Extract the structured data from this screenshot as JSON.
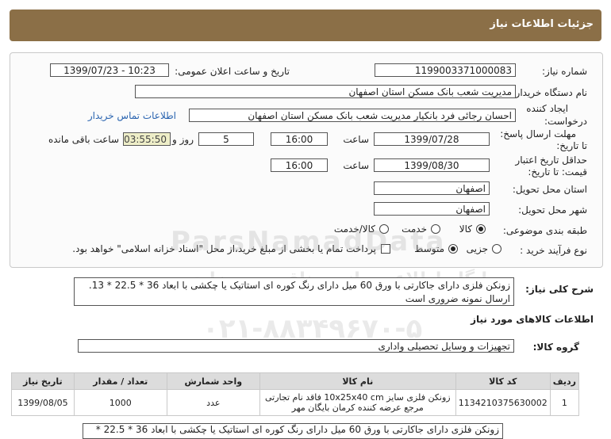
{
  "header": {
    "title": "جزئیات اطلاعات نیاز"
  },
  "fields": {
    "need_number_label": "شماره نیاز:",
    "need_number": "1199003371000083",
    "announce_label": "تاریخ و ساعت اعلان عمومی:",
    "announce_value": "1399/07/23 - 10:23",
    "buyer_label": "نام دستگاه خریدار:",
    "buyer_value": "مدیریت شعب بانک مسکن استان اصفهان",
    "creator_label_1": "ایجاد کننده",
    "creator_label_2": "درخواست:",
    "creator_value": "احسان  رجائی فرد  بانکیار  مدیریت شعب بانک مسکن استان اصفهان",
    "contact_link": "اطلاعات تماس خریدار",
    "deadline_label_1": "مهلت ارسال پاسخ:",
    "deadline_label_2": "تا تاریخ:",
    "deadline_date": "1399/07/28",
    "time_label": "ساعت",
    "deadline_time": "16:00",
    "days_value": "5",
    "days_label": "روز و",
    "remaining_time": "03:55:50",
    "remaining_label": "ساعت باقی مانده",
    "validity_label_1": "حداقل تاریخ اعتبار",
    "validity_label_2": "قیمت: تا تاریخ:",
    "validity_date": "1399/08/30",
    "validity_time_label": "ساعت",
    "validity_time": "16:00",
    "province_label": "استان محل تحویل:",
    "province_value": "اصفهان",
    "city_label": "شهر محل تحویل:",
    "city_value": "اصفهان",
    "category_label": "طبقه بندی موضوعی:",
    "category_options": [
      "کالا",
      "خدمت",
      "کالا/خدمت"
    ],
    "purchase_label": "نوع فرآیند خرید :",
    "purchase_options": [
      "جزیی",
      "متوسط"
    ],
    "payment_note": "پرداخت تمام یا بخشی از مبلغ خرید،از محل \"اسناد خزانه اسلامی\" خواهد بود."
  },
  "summary": {
    "label": "شرح کلی نیاز:",
    "text": "زونکن فلزی دارای جاکارتی با ورق 60 میل دارای رنگ کوره ای استاتیک یا چکشی با ابعاد 36 * 22.5 * 13. ارسال نمونه ضروری است"
  },
  "goods": {
    "section_title": "اطلاعات کالاهای مورد نیاز",
    "group_label": "گروه کالا:",
    "group_value": "تجهیزات و وسایل تحصیلی واداری",
    "columns": [
      "ردیف",
      "کد کالا",
      "نام کالا",
      "واحد شمارش",
      "تعداد / مقدار",
      "تاریخ نیاز"
    ],
    "rows": [
      {
        "row": "1",
        "code": "1134210375630002",
        "name": "زونکن فلزی سایز 10x25x40 cm فاقد نام تجارتی مرجع عرضه کننده کرمان بایگان مهر",
        "unit": "عدد",
        "qty": "1000",
        "date": "1399/08/05"
      }
    ]
  },
  "bottom_text": "زونکن فلزی دارای جاکارتی با ورق 60 میل دارای رنگ کوره ای استاتیک یا چکشی با ابعاد 36 * 22.5 *",
  "watermark": {
    "brand": "ParsNamadData",
    "line2": "پایگاه اطلاع رسانی مناقصه و مزایده",
    "phone": "۰۲۱-۸۸۳۴۹۶۷۰-۵"
  }
}
